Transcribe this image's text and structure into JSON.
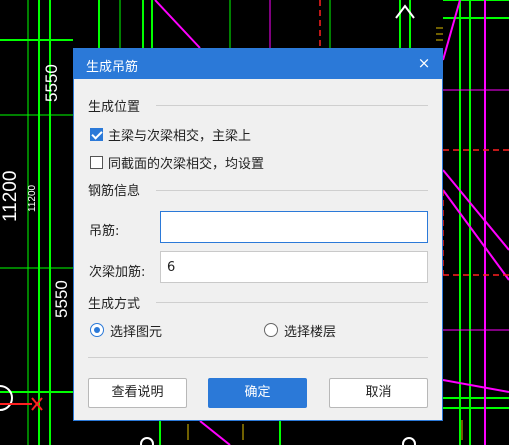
{
  "cad": {
    "dim_top": "5550",
    "dim_middle": "11200",
    "dim_middle_small": "11200",
    "dim_bottom": "5550"
  },
  "dialog": {
    "title": "生成吊筋",
    "close_label": "×",
    "position_section": "生成位置",
    "options": [
      {
        "label": "主梁与次梁相交，主梁上",
        "checked": true
      },
      {
        "label": "同截面的次梁相交，均设置",
        "checked": false
      }
    ],
    "rebar_section": "钢筋信息",
    "hanger_label": "吊筋:",
    "hanger_value": "",
    "secondary_label": "次梁加筋:",
    "secondary_value": "6",
    "method_section": "生成方式",
    "methods": [
      {
        "label": "选择图元",
        "selected": true
      },
      {
        "label": "选择楼层",
        "selected": false
      }
    ],
    "help_button": "查看说明",
    "ok_button": "确定",
    "cancel_button": "取消"
  },
  "colors": {
    "accent": "#2b79d8",
    "cad_background": "#000000",
    "cad_green": "#00ff00",
    "cad_magenta": "#ff00ff",
    "cad_red": "#ff2020"
  }
}
